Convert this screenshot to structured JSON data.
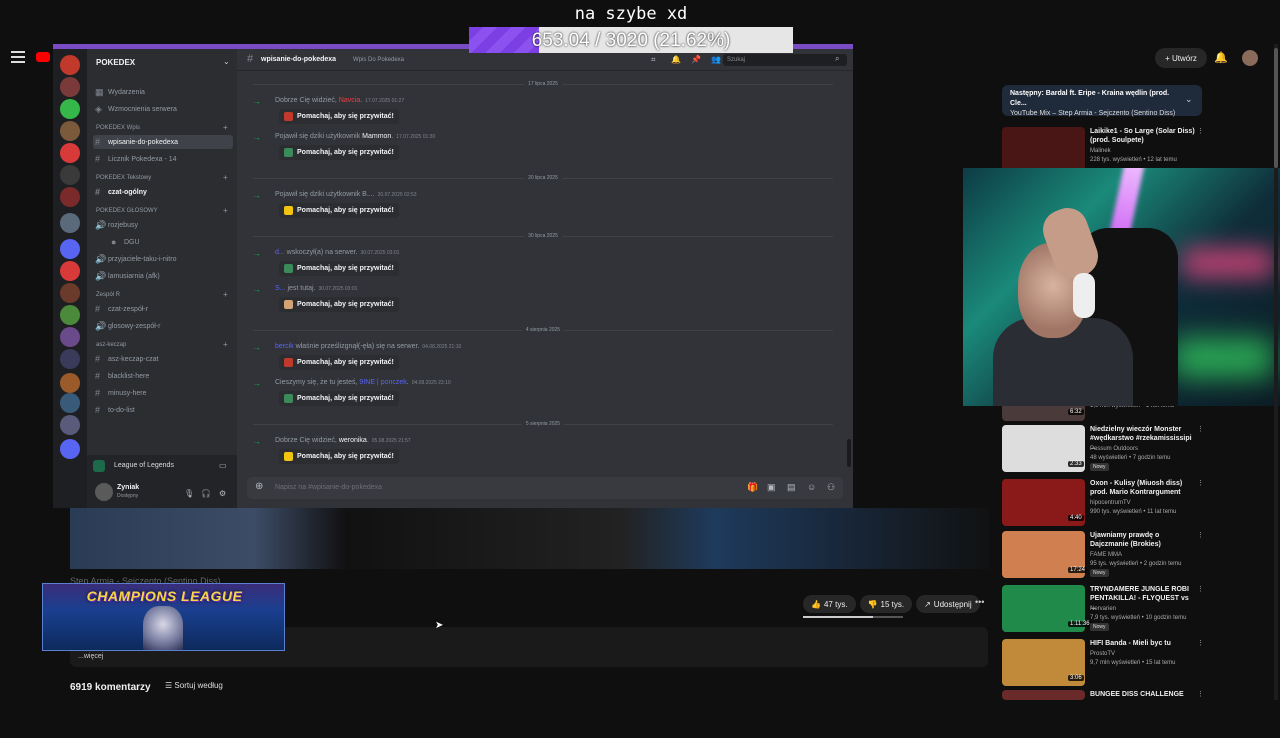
{
  "overlay": {
    "title": "na szybe xd",
    "goal_text": "653.04 / 3020 (21.62%)",
    "goal_fraction": 0.2162,
    "accent": "#7b3fe4"
  },
  "youtube": {
    "create_label": "Utwórz",
    "video_title": "Step Armia - Sejczento (Sentino Diss)",
    "likes": "47 tys.",
    "dislikes": "15 tys.",
    "share_label": "Udostępnij",
    "desc_more": "...więcej",
    "comments_count": "6919 komentarzy",
    "sort_label": "Sortuj według",
    "up_next_prefix": "Następny:",
    "up_next_title": "Bardal ft. Eripe - Kraina wędlin (prod. Cle...",
    "up_next_sub": "YouTube Mix – Step Armia - Sejczento (Sentino Diss)",
    "recommendations": [
      {
        "title": "Laikike1 - So Large (Solar Diss) (prod. Soulpete)",
        "channel": "Malinek",
        "meta": "228 tys. wyświetleń • 12 lat temu",
        "duration": "",
        "color": "#4a1515",
        "new": false
      },
      {
        "title": "",
        "channel": "",
        "meta": "1,6 mln wyświetleń • 1 rok temu",
        "duration": "6:32",
        "color": "#4a3a3a",
        "new": false
      },
      {
        "title": "Niedzielny wieczór Monster #wędkarstwo #rzekamississipi ...",
        "channel": "Possum Outdoors",
        "meta": "48 wyświetleń • 7 godzin temu",
        "duration": "2:33",
        "color": "#ddd",
        "new": true
      },
      {
        "title": "Oxon - Kulisy (Miuosh diss) prod. Mario Kontrargument",
        "channel": "hipocentrumTV",
        "meta": "990 tys. wyświetleń • 11 lat temu",
        "duration": "4:40",
        "color": "#8a1a1a",
        "new": false
      },
      {
        "title": "Ujawniamy prawdę o Dajczmanie (Brokies)",
        "channel": "FAME MMA",
        "meta": "95 tys. wyświetleń • 2 godzin temu",
        "duration": "17:24",
        "color": "#d08050",
        "new": true
      },
      {
        "title": "TRYNDAMERE JUNGLE ROBI PENTAKILLA! - FLYQUEST vs ...",
        "channel": "Nervarien",
        "meta": "7,9 tys. wyświetleń • 10 godzin temu",
        "duration": "1:11:36",
        "color": "#1f8a4a",
        "new": true
      },
      {
        "title": "HIFI Banda - Mieli byc tu",
        "channel": "ProstoTV",
        "meta": "9,7 mln wyświetleń • 15 lat temu",
        "duration": "3:06",
        "color": "#c08a3a",
        "new": false
      },
      {
        "title": "BUNGEE DISS CHALLENGE",
        "channel": "",
        "meta": "",
        "duration": "",
        "color": "#6a2a2a",
        "new": false
      }
    ]
  },
  "cam_overlay": {
    "text": "CHAMPIONS LEAGUE"
  },
  "discord": {
    "server_name": "POKEDEX",
    "sidebar": [
      {
        "kind": "ch",
        "label": "Wydarzenia",
        "icon": "calendar-icon"
      },
      {
        "kind": "ch",
        "label": "Wzmocnienia serwera",
        "icon": "boost-icon"
      },
      {
        "kind": "cat",
        "label": "POKEDEX Wpis"
      },
      {
        "kind": "ch",
        "label": "wpisanie-do-pokedexa",
        "icon": "hash",
        "active": true
      },
      {
        "kind": "ch",
        "label": "Licznik Pokedexa - 14",
        "icon": "hash"
      },
      {
        "kind": "cat",
        "label": "POKEDEX Tekstowy"
      },
      {
        "kind": "ch",
        "label": "czat-ogólny",
        "icon": "hash",
        "bright": true
      },
      {
        "kind": "cat",
        "label": "POKEDEX GŁOSOWY"
      },
      {
        "kind": "ch",
        "label": "rozjebusy",
        "icon": "speaker"
      },
      {
        "kind": "ch",
        "label": "DGU",
        "icon": "user",
        "indent": true
      },
      {
        "kind": "ch",
        "label": "przyjaciele-taku-i-nitro",
        "icon": "speaker"
      },
      {
        "kind": "ch",
        "label": "lamusiarnia (afk)",
        "icon": "speaker"
      },
      {
        "kind": "cat",
        "label": "Zespół R"
      },
      {
        "kind": "ch",
        "label": "czat-zespół-r",
        "icon": "hash"
      },
      {
        "kind": "ch",
        "label": "glosowy-zespół-r",
        "icon": "speaker"
      },
      {
        "kind": "cat",
        "label": "asz-keczap"
      },
      {
        "kind": "ch",
        "label": "asz-keczap-czat",
        "icon": "hash"
      },
      {
        "kind": "ch",
        "label": "blacklist-here",
        "icon": "hash"
      },
      {
        "kind": "ch",
        "label": "minusy-here",
        "icon": "hash"
      },
      {
        "kind": "ch",
        "label": "to-do-list",
        "icon": "hash"
      }
    ],
    "activity": "League of Legends",
    "user": {
      "name": "Zyniak",
      "status": "Dostępny"
    },
    "channel": {
      "name": "wpisanie-do-pokedexa",
      "topic": "Wpis Do Pokedexa"
    },
    "search_placeholder": "Szukaj",
    "composer_placeholder": "Napisz na #wpisanie-do-pokedexa",
    "wave_label": "Pomachaj, aby się przywitać!",
    "feed": [
      {
        "type": "date",
        "text": "17 lipca 2025"
      },
      {
        "type": "msg",
        "pre": "Dobrze Cię widzieć, ",
        "who": "Navcia",
        "post": ".",
        "ts": "17.07.2025 01:27",
        "who_color": "#f23f43",
        "sticker": "#c0392b"
      },
      {
        "type": "msg",
        "pre": "Pojawił się dziki użytkownik ",
        "who": "Mammon",
        "post": ".",
        "ts": "17.07.2025 01:30",
        "who_color": "#f2f3f5",
        "sticker": "#3a8a5a"
      },
      {
        "type": "date",
        "text": "20 lipca 2025"
      },
      {
        "type": "msg",
        "pre": "Pojawił się dziki użytkownik ",
        "who": "B...",
        "post": ".",
        "ts": "20.07.2025 02:53",
        "who_color": "#949ba4",
        "sticker": "#f1c40f"
      },
      {
        "type": "date",
        "text": "30 lipca 2025"
      },
      {
        "type": "msg",
        "pre": "",
        "who": "d...",
        "post": " wskoczył(a) na serwer.",
        "ts": "30.07.2025 03:01",
        "who_color": "#5865f2",
        "sticker": "#3a8a5a"
      },
      {
        "type": "msg",
        "pre": "",
        "who": "S...",
        "post": " jest tutaj.",
        "ts": "30.07.2025 03:01",
        "who_color": "#5865f2",
        "sticker": "#d4a373"
      },
      {
        "type": "date",
        "text": "4 sierpnia 2025"
      },
      {
        "type": "msg",
        "pre": "",
        "who": "bercik",
        "post": " właśnie prześlizgnął(-ęła) się na serwer.",
        "ts": "04.08.2025 21:10",
        "who_color": "#5865f2",
        "sticker": "#c0392b"
      },
      {
        "type": "msg",
        "pre": "Cieszymy się, że tu jesteś, ",
        "who": "9INE | ponczek",
        "post": ".",
        "ts": "04.08.2025 23:10",
        "who_color": "#5865f2",
        "sticker": "#3a8a5a"
      },
      {
        "type": "date",
        "text": "5 sierpnia 2025"
      },
      {
        "type": "msg",
        "pre": "Dobrze Cię widzieć, ",
        "who": "weronika",
        "post": ".",
        "ts": "05.08.2025 21:57",
        "who_color": "#f2f3f5",
        "sticker": "#f1c40f"
      }
    ]
  }
}
